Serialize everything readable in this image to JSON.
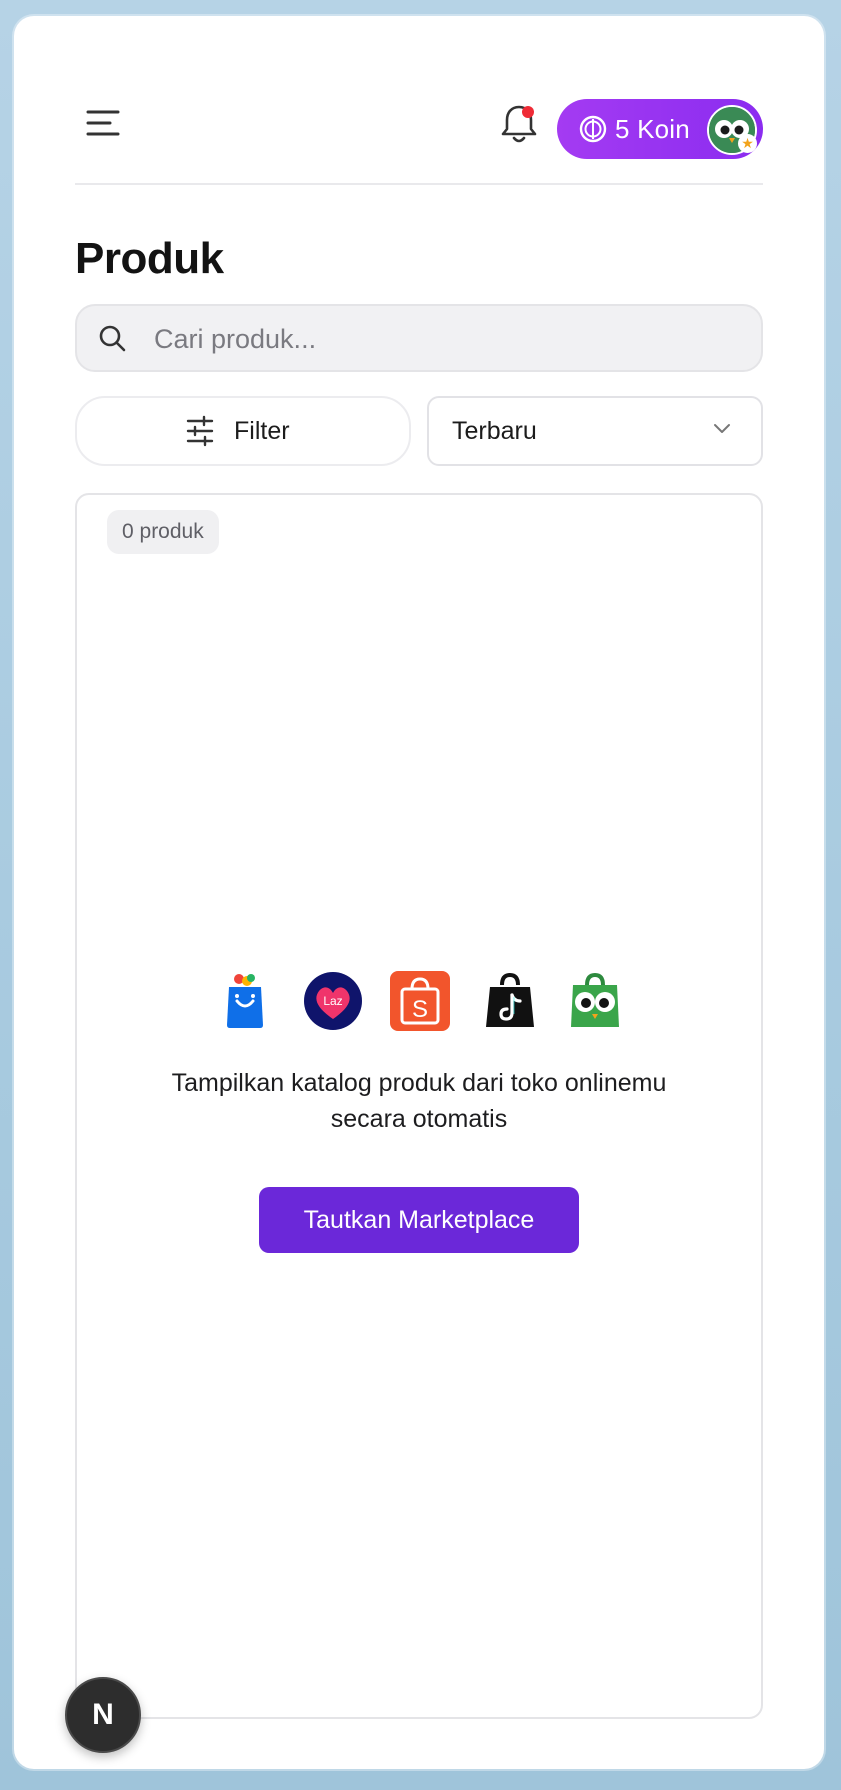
{
  "header": {
    "menu_icon": "hamburger-icon",
    "bell_icon": "bell-icon",
    "has_unread_notification": true,
    "coins": {
      "label": "5 Koin",
      "icon": "coin-icon"
    },
    "avatar_icon": "owl-avatar"
  },
  "page": {
    "title": "Produk"
  },
  "search": {
    "placeholder": "Cari produk...",
    "value": ""
  },
  "filter": {
    "label": "Filter",
    "icon": "sliders-icon"
  },
  "sort": {
    "selected": "Terbaru",
    "icon": "chevron-down-icon"
  },
  "products": {
    "count_label": "0 produk",
    "marketplaces": [
      "blibli",
      "lazada",
      "shopee",
      "tiktok-shop",
      "tokopedia"
    ],
    "empty_message": "Tampilkan katalog produk dari toko onlinemu secara otomatis",
    "link_button_label": "Tautkan Marketplace"
  },
  "dev_badge": {
    "label": "N"
  },
  "colors": {
    "accent": "#6b28d9",
    "coin_pill": "#9a33f1",
    "notification_dot": "#ef2b36",
    "background": "#a9cbe0"
  }
}
